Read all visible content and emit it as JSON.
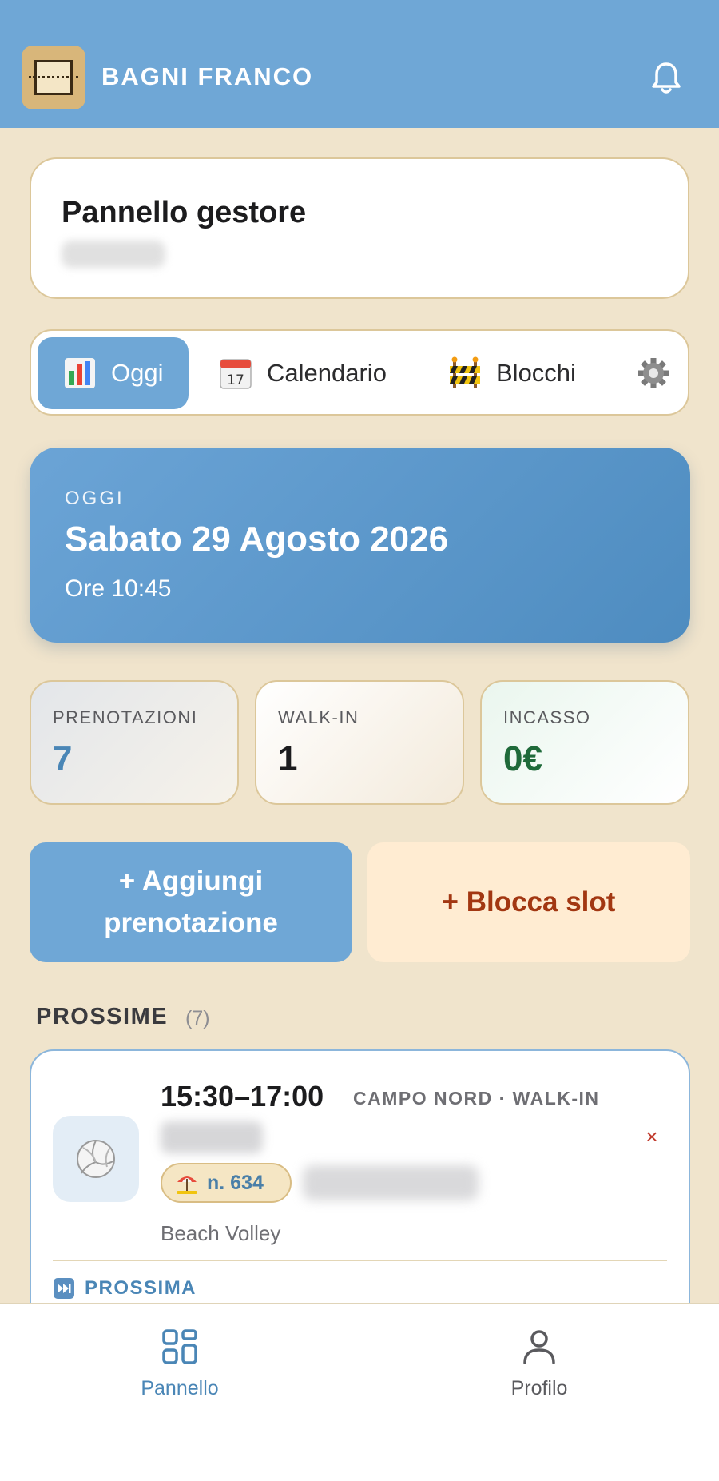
{
  "header": {
    "brand": "BAGNI FRANCO",
    "logo_icon": "beach-court-logo",
    "notifications_icon": "bell-icon"
  },
  "manager": {
    "title": "Pannello gestore"
  },
  "tabs": [
    {
      "label": "Oggi",
      "icon": "bar-chart-icon",
      "active": true
    },
    {
      "label": "Calendario",
      "icon": "calendar-icon",
      "active": false
    },
    {
      "label": "Blocchi",
      "icon": "roadblock-icon",
      "active": false
    },
    {
      "label": "",
      "icon": "gear-icon",
      "active": false
    }
  ],
  "today": {
    "label": "OGGI",
    "date": "Sabato 29 Agosto 2026",
    "time": "Ore 10:45"
  },
  "stats": [
    {
      "label": "PRENOTAZIONI",
      "value": "7",
      "color": "#4a86b6"
    },
    {
      "label": "WALK-IN",
      "value": "1",
      "color": "#1c1c1e"
    },
    {
      "label": "INCASSO",
      "value": "0€",
      "color": "#1f6a3a"
    }
  ],
  "actions": {
    "add_booking": "+ Aggiungi prenotazione",
    "block_slot": "+ Blocca slot"
  },
  "upcoming": {
    "title": "PROSSIME",
    "count": "(7)",
    "booking": {
      "time_range": "15:30–17:00",
      "meta": "CAMPO NORD · WALK-IN",
      "umbrella": "n. 634",
      "sport": "Beach Volley",
      "remove": "×",
      "next_label": "PROSSIMA",
      "sport_icon": "volleyball-icon"
    }
  },
  "nav": {
    "panel": "Pannello",
    "profile": "Profilo"
  },
  "colors": {
    "accent": "#6fa7d6",
    "background": "#f0e4cc",
    "border": "#dcc79a",
    "danger": "#c0392b"
  }
}
